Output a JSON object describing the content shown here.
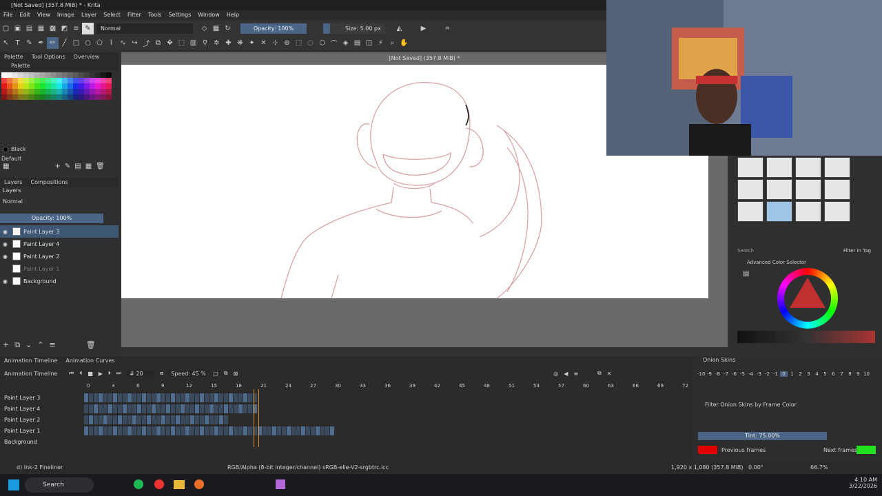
{
  "window": {
    "title": "[Not Saved]  (357.8 MiB) * - Krita",
    "doc_title": "[Not Saved]  (357.8 MiB) *"
  },
  "menu": [
    "File",
    "Edit",
    "View",
    "Image",
    "Layer",
    "Select",
    "Filter",
    "Tools",
    "Settings",
    "Window",
    "Help"
  ],
  "toolbar": {
    "blend_mode": "Normal",
    "opacity": "Opacity: 100%",
    "size": "Size: 5.00 px"
  },
  "left_tabs": [
    "Palette",
    "Tool Options",
    "Overview"
  ],
  "palette": {
    "title": "Palette",
    "color_name": "Black",
    "palette_name": "Default"
  },
  "layers_panel": {
    "tabs": [
      "Layers",
      "Compositions"
    ],
    "blend": "Normal",
    "opacity": "Opacity:  100%",
    "layers": [
      {
        "name": "Paint Layer 3",
        "selected": true
      },
      {
        "name": "Paint Layer 4",
        "selected": false
      },
      {
        "name": "Paint Layer 2",
        "selected": false
      },
      {
        "name": "Paint Layer 1",
        "selected": false,
        "hidden": true
      },
      {
        "name": "Background",
        "selected": false
      }
    ]
  },
  "brushes": {
    "search_placeholder": "Search",
    "filter_tag": "Filter in Tag"
  },
  "color_selector": {
    "title": "Advanced Color Selector"
  },
  "timeline": {
    "tabs": [
      "Animation Timeline",
      "Animation Curves"
    ],
    "label": "Animation Timeline",
    "frame": "20",
    "speed": "Speed: 45 %",
    "ruler": [
      "0",
      "3",
      "6",
      "9",
      "12",
      "15",
      "18",
      "21",
      "24",
      "27",
      "30",
      "33",
      "36",
      "39",
      "42",
      "45",
      "48",
      "51",
      "54",
      "57",
      "60",
      "63",
      "66",
      "69",
      "72"
    ],
    "rows": [
      "Paint Layer 3",
      "Paint Layer 4",
      "Paint Layer 2",
      "Paint Layer 1",
      "Background"
    ]
  },
  "onion": {
    "title": "Onion Skins",
    "numbers": [
      "-10",
      "-9",
      "-8",
      "-7",
      "-6",
      "-5",
      "-4",
      "-3",
      "-2",
      "-1",
      "0",
      "1",
      "2",
      "3",
      "4",
      "5",
      "6",
      "7",
      "8",
      "9",
      "10"
    ],
    "filter": "Filter Onion Skins by Frame Color",
    "tint": "Tint: 75.00%",
    "prev": "Previous frames",
    "next": "Next frames"
  },
  "status": {
    "brush": "d) Ink-2 Fineliner",
    "color_info": "RGB/Alpha (8-bit integer/channel)  sRGB-elle-V2-srgbtrc.icc",
    "dims": "1,920 x 1,080 (357.8 MiB)",
    "rotation": "0.00°",
    "zoom": "66.7%"
  },
  "taskbar": {
    "search": "Search",
    "time": "4:10 AM",
    "date": "3/22/2026"
  },
  "colors": {
    "accent": "#4f6c8e",
    "prev_frames": "#e00000",
    "next_frames": "#20e020"
  }
}
